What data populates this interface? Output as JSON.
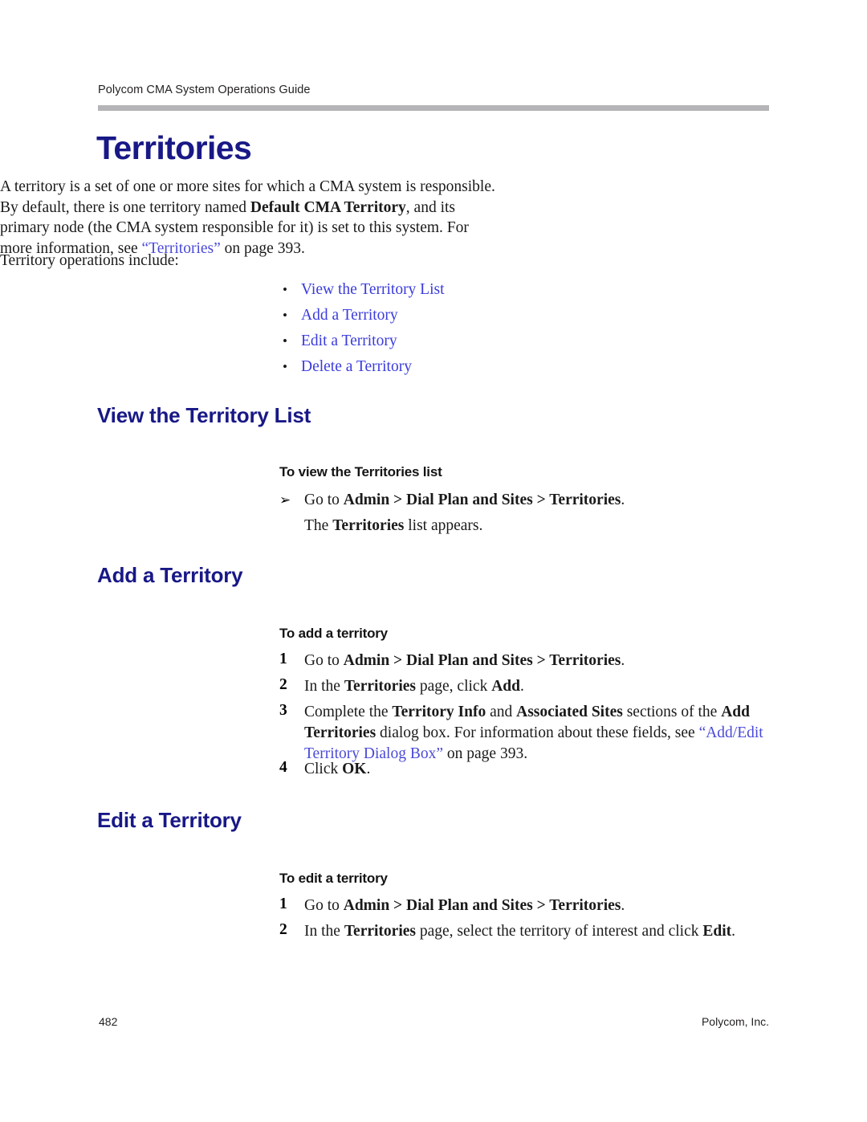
{
  "header": {
    "running_title": "Polycom CMA System Operations Guide"
  },
  "chapter": {
    "title": "Territories"
  },
  "intro": {
    "paragraph_part1": "A territory is a set of one or more sites for which a CMA system is responsible. By default, there is one territory named ",
    "bold_default_territory": "Default CMA Territory",
    "paragraph_part2": ", and its primary node (the CMA system responsible for it) is set to this system. For more information, see ",
    "xref_territories": "“Territories”",
    "paragraph_part3": " on page 393.",
    "operations_lead_in": "Territory operations include:"
  },
  "operations_links": [
    {
      "label": "View the Territory List"
    },
    {
      "label": "Add a Territory"
    },
    {
      "label": "Edit a Territory"
    },
    {
      "label": "Delete a Territory"
    }
  ],
  "bullet_glyph": "•",
  "arrow_glyph": "➢",
  "sections": [
    {
      "heading": "View the Territory List",
      "procedure_heading": "To view the Territories list",
      "steps": [
        {
          "marker": "➢",
          "t1": "Go to ",
          "b1": "Admin > Dial Plan and Sites > Territories",
          "t2": "."
        },
        {
          "marker": "",
          "t1": "The ",
          "b1": "Territories",
          "t2": " list appears."
        }
      ]
    },
    {
      "heading": "Add a Territory",
      "procedure_heading": "To add a territory",
      "steps": [
        {
          "marker": "1",
          "t1": "Go to ",
          "b1": "Admin > Dial Plan and Sites > Territories",
          "t2": "."
        },
        {
          "marker": "2",
          "t1": "In the ",
          "b1": "Territories",
          "t2": " page, click ",
          "b2": "Add",
          "t3": "."
        },
        {
          "marker": "3",
          "t1": "Complete the ",
          "b1": "Territory Info",
          "t2": " and ",
          "b2": "Associated Sites",
          "t3": " sections of the ",
          "b3": "Add Territories",
          "t4": " dialog box. For information about these fields, see ",
          "xref": "“Add/Edit Territory Dialog Box”",
          "t5": " on page 393."
        },
        {
          "marker": "4",
          "t1": "Click ",
          "b1": "OK",
          "t2": "."
        }
      ]
    },
    {
      "heading": "Edit a Territory",
      "procedure_heading": "To edit a territory",
      "steps": [
        {
          "marker": "1",
          "t1": "Go to ",
          "b1": "Admin > Dial Plan and Sites > Territories",
          "t2": "."
        },
        {
          "marker": "2",
          "t1": "In the ",
          "b1": "Territories",
          "t2": " page, select the territory of interest and click ",
          "b2": "Edit",
          "t3": "."
        }
      ]
    }
  ],
  "footer": {
    "page_number": "482",
    "company": "Polycom, Inc."
  },
  "colors": {
    "heading_blue": "#181887",
    "link_blue": "#3b3bdd",
    "xref_blue": "#4a4ad8",
    "rule_gray": "#b5b5b8"
  }
}
